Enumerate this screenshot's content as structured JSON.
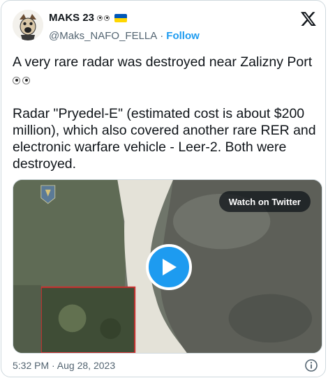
{
  "author": {
    "display_name": "MAKS 23",
    "handle": "@Maks_NAFO_FELLA",
    "separator": "·",
    "follow_label": "Follow",
    "name_icons": [
      "eyes-emoji",
      "ukraine-flag"
    ]
  },
  "tweet": {
    "line1": "A very rare radar was destroyed near Zalizny Port",
    "line1_emoji": "eyes-emoji",
    "line2": "Radar \"Pryedel-E\" (estimated cost is about $200 million), which also covered another rare RER and electronic warfare vehicle - Leer-2.  Both were destroyed."
  },
  "media": {
    "watch_label": "Watch on Twitter",
    "play_icon": "play-icon"
  },
  "timestamp": "5:32 PM · Aug 28, 2023",
  "colors": {
    "accent": "#1d9bf0",
    "text": "#0f1419",
    "muted": "#536471",
    "border": "#cfd9de"
  }
}
